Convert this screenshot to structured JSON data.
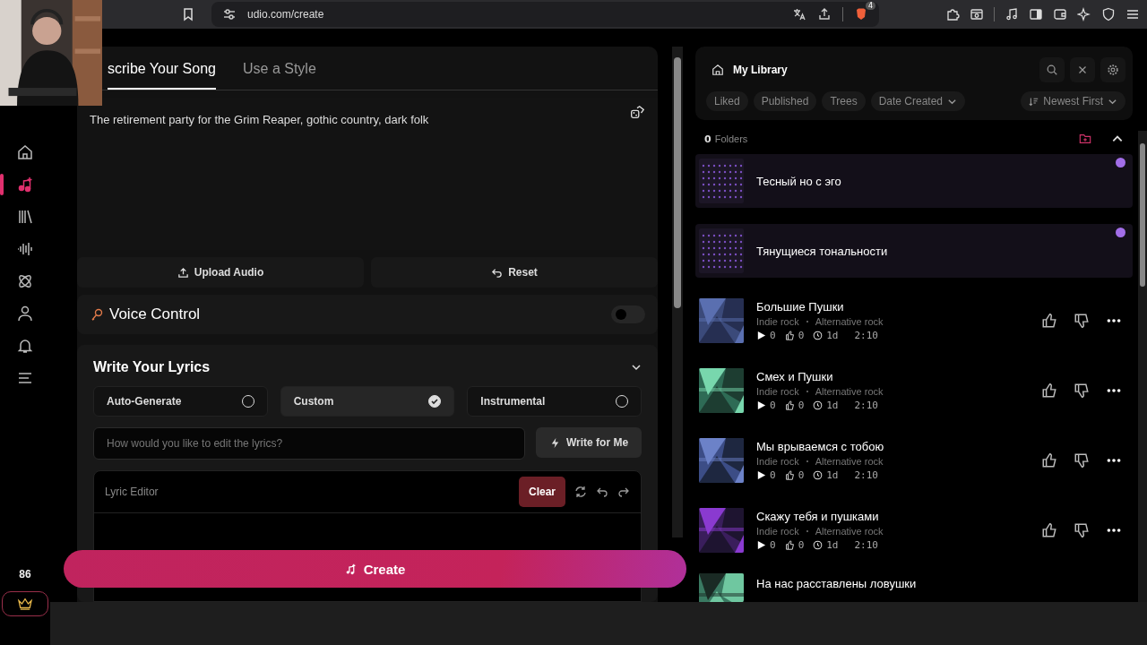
{
  "browser": {
    "url": "udio.com/create",
    "extension_badge": "4"
  },
  "sidebar": {
    "items": [
      {
        "kind": "home",
        "selected": false
      },
      {
        "kind": "create",
        "selected": true
      },
      {
        "kind": "library",
        "selected": false
      },
      {
        "kind": "audio",
        "selected": false
      },
      {
        "kind": "explore",
        "selected": false
      },
      {
        "kind": "profile",
        "selected": false
      },
      {
        "kind": "notifications",
        "selected": false
      },
      {
        "kind": "menu",
        "selected": false
      }
    ],
    "credits": "86"
  },
  "prompt": {
    "tabs": [
      {
        "label": "scribe Your Song",
        "selected": true
      },
      {
        "label": "Use a Style",
        "selected": false
      }
    ],
    "text": "The retirement party for the Grim Reaper, gothic country, dark folk",
    "upload_button": "Upload Audio",
    "reset_button": "Reset"
  },
  "voice_control": {
    "label": "Voice Control",
    "on": false
  },
  "lyrics": {
    "title": "Write Your Lyrics",
    "expanded": true,
    "options": [
      {
        "label": "Auto-Generate",
        "selected": false
      },
      {
        "label": "Custom",
        "selected": true
      },
      {
        "label": "Instrumental",
        "selected": false
      }
    ],
    "edit_placeholder": "How would you like to edit the lyrics?",
    "write_button": "Write for Me",
    "editor_label": "Lyric Editor",
    "clear_button": "Clear"
  },
  "create_button": "Create",
  "library": {
    "title": "My Library",
    "filters": [
      {
        "label": "Liked",
        "dropdown": false
      },
      {
        "label": "Published",
        "dropdown": false
      },
      {
        "label": "Trees",
        "dropdown": false
      },
      {
        "label": "Date Created",
        "dropdown": true
      }
    ],
    "sort": "Newest First",
    "folder_count": "0",
    "folder_label": "Folders",
    "folders_expanded": true,
    "songs": [
      {
        "kind": "generating",
        "title": "Тесный но с эго"
      },
      {
        "kind": "generating",
        "title": "Тянущиеся тональности"
      },
      {
        "kind": "track",
        "title": "Большие Пушки",
        "genres": [
          "Indie rock",
          "Alternative rock"
        ],
        "plays": "0",
        "likes": "0",
        "age": "1d",
        "duration": "2:10"
      },
      {
        "kind": "track",
        "title": "Смех и Пушки",
        "genres": [
          "Indie rock",
          "Alternative rock"
        ],
        "plays": "0",
        "likes": "0",
        "age": "1d",
        "duration": "2:10"
      },
      {
        "kind": "track",
        "title": "Мы врываемся с тобою",
        "genres": [
          "Indie rock",
          "Alternative rock"
        ],
        "plays": "0",
        "likes": "0",
        "age": "1d",
        "duration": "2:10"
      },
      {
        "kind": "track",
        "title": "Скажу тебя и пушками",
        "genres": [
          "Indie rock",
          "Alternative rock"
        ],
        "plays": "0",
        "likes": "0",
        "age": "1d",
        "duration": "2:10"
      },
      {
        "kind": "partial",
        "title": "На нас расставлены ловушки"
      }
    ]
  }
}
